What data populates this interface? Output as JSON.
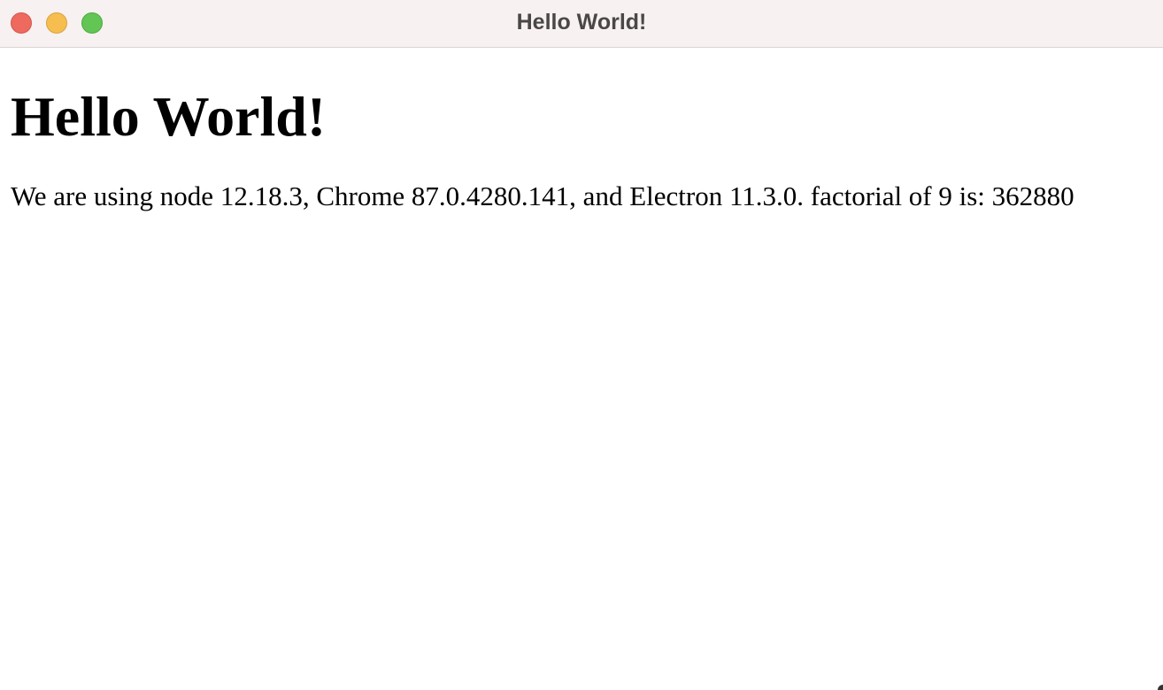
{
  "window": {
    "title": "Hello World!",
    "controls": {
      "close_color": "#ee6a5f",
      "minimize_color": "#f5be4f",
      "zoom_color": "#62c554"
    }
  },
  "page": {
    "heading": "Hello World!",
    "body_text": "We are using node 12.18.3, Chrome 87.0.4280.141, and Electron 11.3.0. factorial of 9 is: 362880"
  }
}
